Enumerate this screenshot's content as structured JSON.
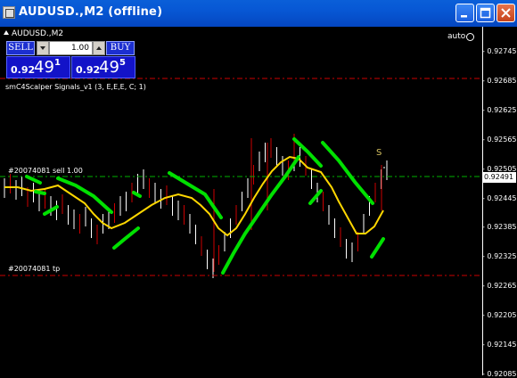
{
  "window": {
    "title": "AUDUSD.,M2 (offline)"
  },
  "chart_header": {
    "symbol": "AUDUSD.,M2",
    "indicator": "smC4Scalper Signals_v1 (3, E,E,E, C; 1)",
    "auto": "auto"
  },
  "trade_panel": {
    "sell_label": "SELL",
    "buy_label": "BUY",
    "lot": "1.00",
    "bid": {
      "small": "0.92",
      "big": "49",
      "sup": "1"
    },
    "ask": {
      "small": "0.92",
      "big": "49",
      "sup": "5"
    }
  },
  "orders": {
    "sell": "#20074081 sell 1.00",
    "tp": "#20074081 tp"
  },
  "signal_label": "S",
  "price_axis": {
    "labels": [
      "0.92745",
      "0.92685",
      "0.92625",
      "0.92565",
      "0.92505",
      "0.92445",
      "0.92385",
      "0.92325",
      "0.92265",
      "0.92205",
      "0.92145",
      "0.92085"
    ],
    "current": "0.92491"
  },
  "colors": {
    "candle_up": "#ffffff",
    "candle_down": "#cc0000",
    "ma_yellow": "#ffd700",
    "signal_green": "#00e000",
    "level_red": "#cc0000",
    "bid_line": "#00b000"
  }
}
